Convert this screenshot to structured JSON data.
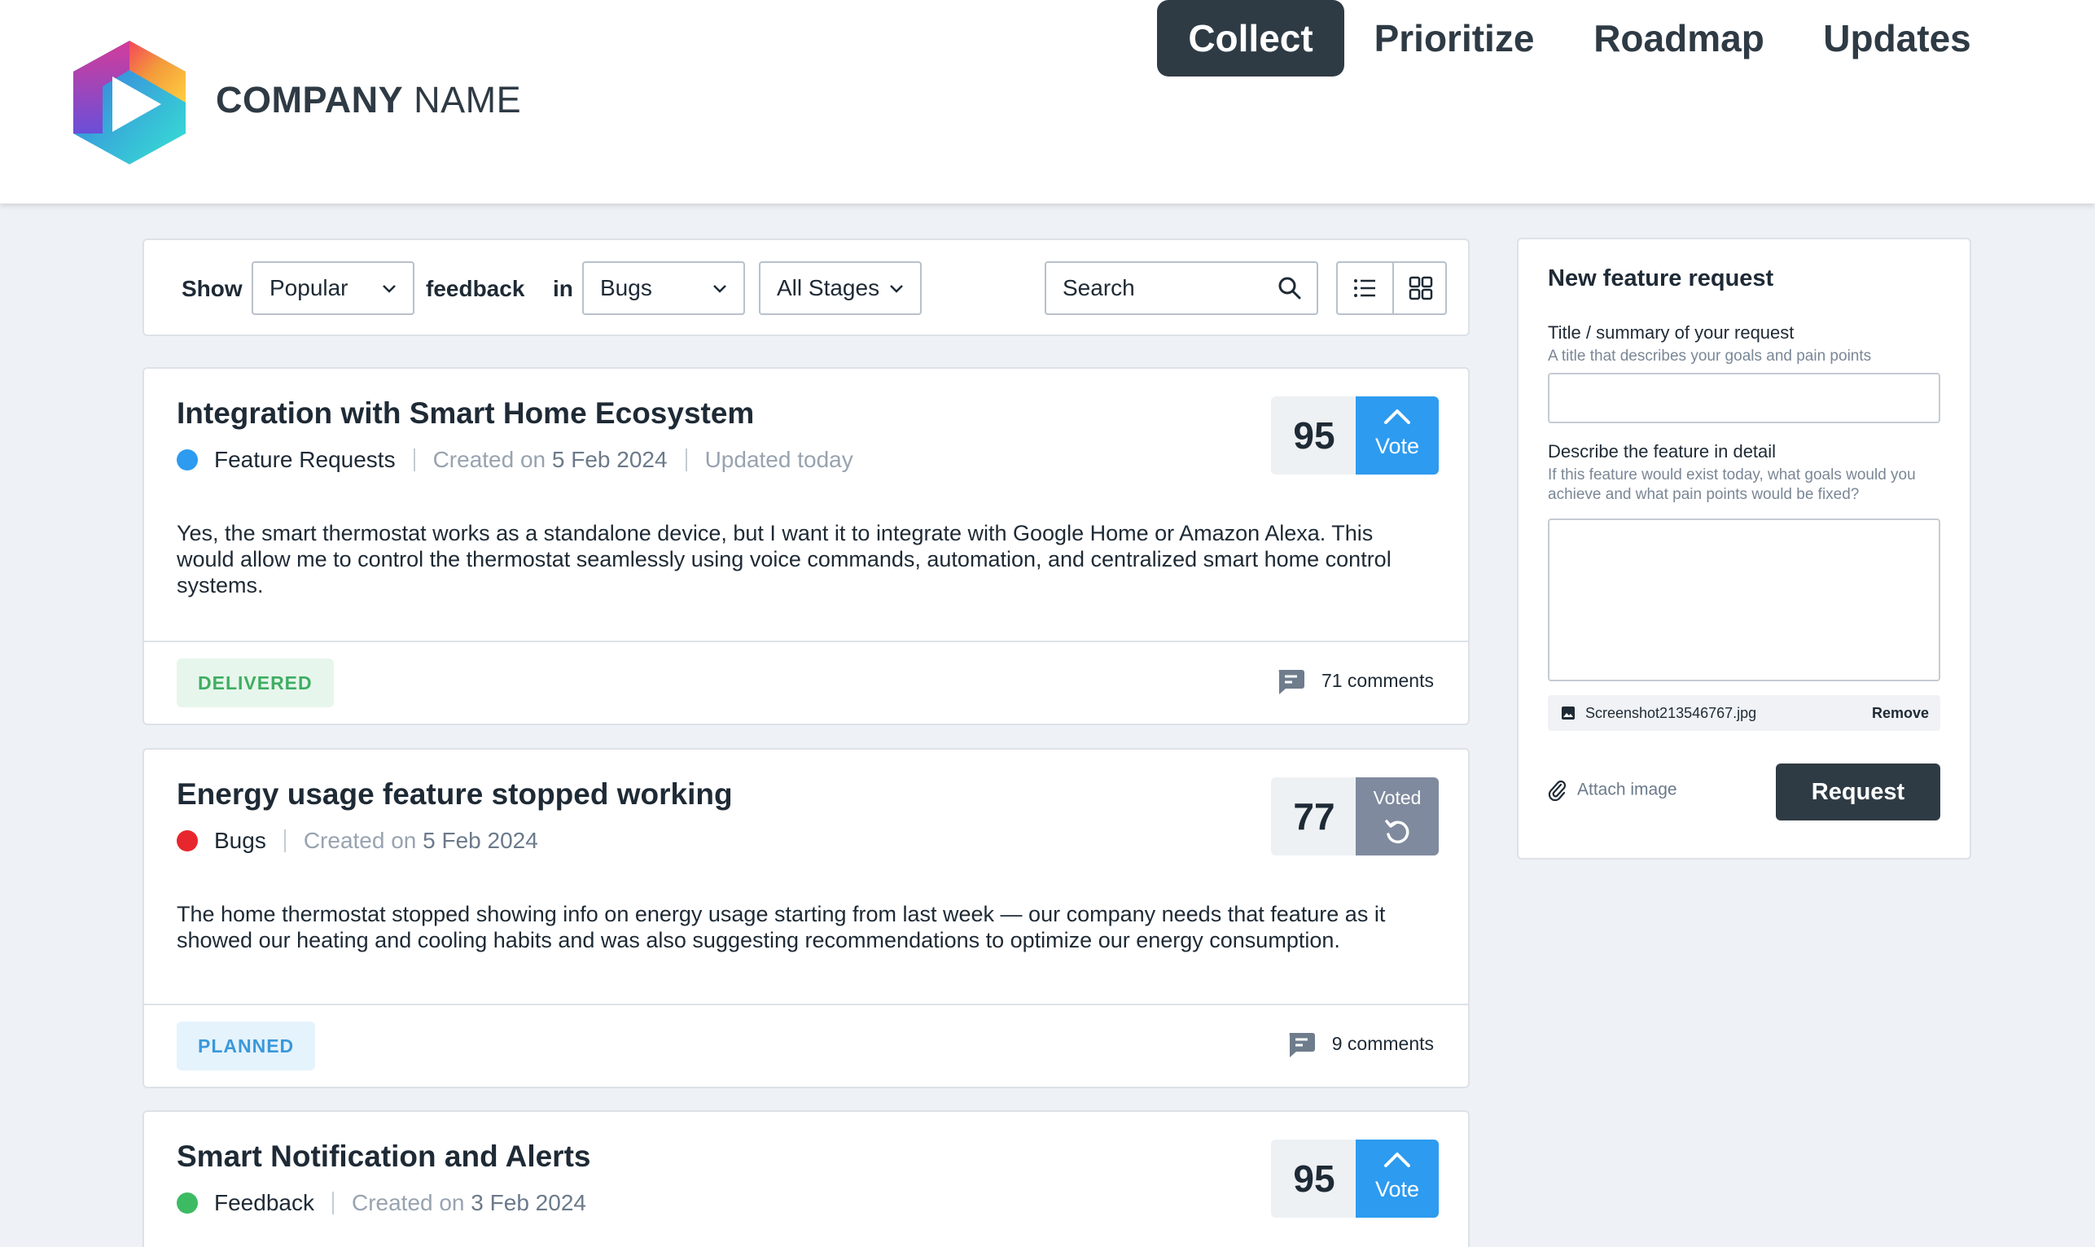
{
  "header": {
    "company_bold": "COMPANY",
    "company_regular": " NAME",
    "nav": [
      {
        "label": "Collect",
        "active": true
      },
      {
        "label": "Prioritize",
        "active": false
      },
      {
        "label": "Roadmap",
        "active": false
      },
      {
        "label": "Updates",
        "active": false
      }
    ]
  },
  "filters": {
    "show_label": "Show",
    "sort_value": "Popular",
    "feedback_label": "feedback",
    "in_label": "in",
    "category_value": "Bugs",
    "stage_value": "All Stages",
    "search_placeholder": "Search"
  },
  "posts": [
    {
      "title": "Integration with Smart Home Ecosystem",
      "category": "Feature Requests",
      "category_color": "#2d9bf0",
      "created_prefix": "Created on",
      "created_date": "5 Feb 2024",
      "updated": "Updated today",
      "description": "Yes, the smart thermostat works as a standalone device, but I want it to integrate with Google Home or Amazon Alexa. This would allow me to control the thermostat seamlessly using voice commands, automation, and centralized smart home control systems.",
      "status": "DELIVERED",
      "comments": "71 comments",
      "votes": "95",
      "vote_label": "Vote"
    },
    {
      "title": "Energy usage feature stopped working",
      "category": "Bugs",
      "category_color": "#e8262d",
      "created_prefix": "Created on",
      "created_date": "5 Feb 2024",
      "description": "The home thermostat stopped showing info on energy usage starting from last week — our company needs that feature as it showed our heating and cooling habits and was also suggesting recommendations to optimize our energy consumption.",
      "status": "PLANNED",
      "comments": "9 comments",
      "votes": "77",
      "vote_label": "Voted"
    },
    {
      "title": "Smart Notification and Alerts",
      "category": "Feedback",
      "category_color": "#3dbb63",
      "created_prefix": "Created on",
      "created_date": "3 Feb 2024",
      "votes": "95",
      "vote_label": "Vote"
    }
  ],
  "form": {
    "title": "New feature request",
    "title_label": "Title / summary of your request",
    "title_hint": "A title that describes your goals and pain points",
    "detail_label": "Describe the feature in detail",
    "detail_hint": "If this feature would exist today, what goals would you achieve and what pain points would be fixed?",
    "attachment_name": "Screenshot213546767.jpg",
    "remove_label": "Remove",
    "attach_label": "Attach image",
    "submit_label": "Request"
  },
  "icons": {
    "search": "magnifier-icon",
    "list_view": "list-icon",
    "grid_view": "grid-icon",
    "comment": "comment-icon",
    "upvote": "chevron-up-icon",
    "undo": "undo-icon",
    "attach": "paperclip-icon",
    "image": "image-icon"
  }
}
